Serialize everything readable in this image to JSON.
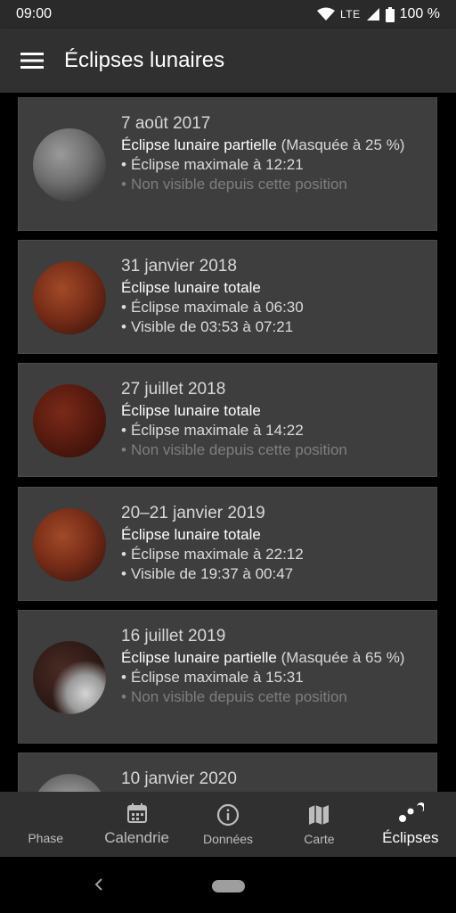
{
  "status": {
    "time": "09:00",
    "network": "LTE",
    "battery": "100 %"
  },
  "header": {
    "title": "Éclipses lunaires"
  },
  "eclipses": [
    {
      "date": "7 août 2017",
      "type": "Éclipse lunaire partielle",
      "mask": "(Masquée à 25 %)",
      "max": "Éclipse maximale à 12:21",
      "visibility": "Non visible depuis cette position"
    },
    {
      "date": "31 janvier 2018",
      "type": "Éclipse lunaire totale",
      "mask": "",
      "max": "Éclipse maximale à 06:30",
      "visibility": "Visible de 03:53 à 07:21"
    },
    {
      "date": "27 juillet 2018",
      "type": "Éclipse lunaire totale",
      "mask": "",
      "max": "Éclipse maximale à 14:22",
      "visibility": "Non visible depuis cette position"
    },
    {
      "date": "20–21 janvier 2019",
      "type": "Éclipse lunaire totale",
      "mask": "",
      "max": "Éclipse maximale à 22:12",
      "visibility": "Visible de 19:37 à 00:47"
    },
    {
      "date": "16 juillet 2019",
      "type": "Éclipse lunaire partielle",
      "mask": "(Masquée à 65 %)",
      "max": "Éclipse maximale à 15:31",
      "visibility": "Non visible depuis cette position"
    },
    {
      "date": "10 janvier 2020",
      "type": "",
      "mask": "",
      "max": "",
      "visibility": ""
    }
  ],
  "nav": {
    "items": [
      {
        "label": "Phase",
        "icon": "moon-phase-icon"
      },
      {
        "label": "Calendrie",
        "icon": "calendar-icon"
      },
      {
        "label": "Données",
        "icon": "info-icon"
      },
      {
        "label": "Carte",
        "icon": "map-icon"
      },
      {
        "label": "Éclipses",
        "icon": "eclipse-icon"
      }
    ],
    "active": "Éclipses"
  },
  "colors": {
    "background": "#000000",
    "card": "#3e3e3e",
    "bar": "#303030",
    "dim_text": "#7e7e7e"
  }
}
